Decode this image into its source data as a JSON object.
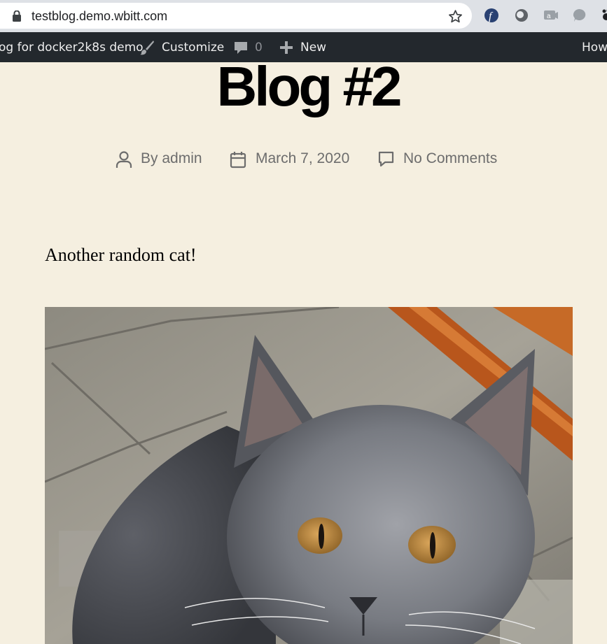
{
  "browser": {
    "url": "testblog.demo.wbitt.com"
  },
  "admin_bar": {
    "site_name": "og for docker2k8s demo",
    "customize": "Customize",
    "comments_count": "0",
    "new": "New",
    "howdy": "How"
  },
  "post": {
    "title": "Blog #2",
    "author": "By admin",
    "date": "March 7, 2020",
    "comments": "No Comments",
    "excerpt": "Another random cat!"
  },
  "colors": {
    "page_bg": "#f5efe0",
    "admin_bar_bg": "#23282d",
    "meta_text": "#6d6d6d"
  }
}
